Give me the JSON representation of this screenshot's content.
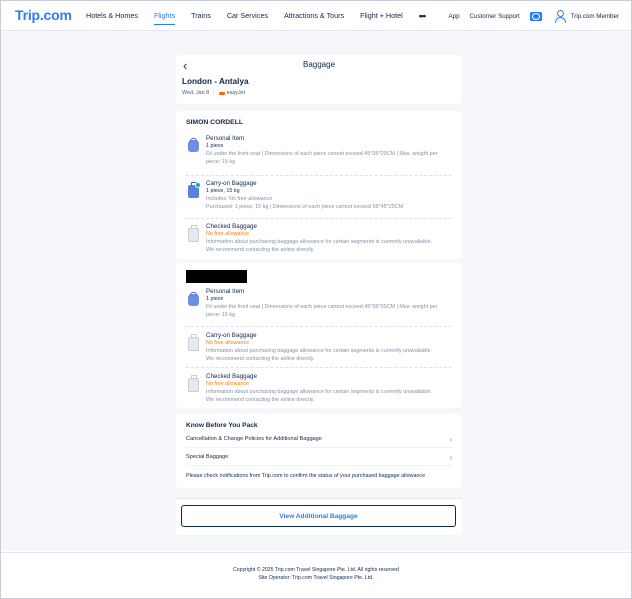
{
  "header": {
    "logo": "Trip.com",
    "nav": [
      {
        "label": "Hotels & Homes",
        "active": false
      },
      {
        "label": "Flights",
        "active": true
      },
      {
        "label": "Trains",
        "active": false
      },
      {
        "label": "Car Services",
        "active": false
      },
      {
        "label": "Attractions & Tours",
        "active": false
      },
      {
        "label": "Flight + Hotel",
        "active": false
      }
    ],
    "more_icon": "more-dots-icon",
    "app_link": "App",
    "support_link": "Customer Support",
    "member_label": "Trip.com Member"
  },
  "page": {
    "title": "Baggage",
    "route": "London - Antalya",
    "date": "Wed, Jan 8",
    "airline": "easyJet"
  },
  "passengers": [
    {
      "name": "SIMON CORDELL",
      "redacted": false,
      "items": [
        {
          "icon": "personal-item-icon",
          "title": "Personal Item",
          "sub": "1 piece",
          "sub_warn": false,
          "desc": [
            "Fit under the front seat | Dimensions of each piece cannot exceed 45*36*20CM | Max. weight per piece: 15 kg"
          ]
        },
        {
          "icon": "carry-on-icon",
          "title": "Carry-on Baggage",
          "sub": "1 piece, 15 kg",
          "sub_warn": false,
          "desc": [
            "Includes:  No free allowance",
            "Purchased: 1 piece, 15 kg | Dimensions of each piece cannot exceed 56*45*25CM"
          ]
        },
        {
          "icon": "checked-baggage-icon",
          "title": "Checked Baggage",
          "sub": "No free allowance",
          "sub_warn": true,
          "desc": [
            "Information about purchasing baggage allowance for certain segments is currently unavailable.",
            "We recommend contacting the airline directly."
          ]
        }
      ]
    },
    {
      "name": "",
      "redacted": true,
      "items": [
        {
          "icon": "personal-item-icon",
          "title": "Personal Item",
          "sub": "1 piece",
          "sub_warn": false,
          "desc": [
            "Fit under the front seat | Dimensions of each piece cannot exceed 45*36*20CM | Max. weight per piece: 15 kg"
          ]
        },
        {
          "icon": "carry-on-icon",
          "title": "Carry-on Baggage",
          "sub": "No free allowance",
          "sub_warn": true,
          "desc": [
            "Information about purchasing baggage allowance for certain segments is currently unavailable.",
            "We recommend contacting the airline directly."
          ]
        },
        {
          "icon": "checked-baggage-icon",
          "title": "Checked Baggage",
          "sub": "No free allowance",
          "sub_warn": true,
          "desc": [
            "Information about purchasing baggage allowance for certain segments is currently unavailable.",
            "We recommend contacting the airline directly."
          ]
        }
      ]
    }
  ],
  "know": {
    "title": "Know Before You Pack",
    "links": [
      "Cancellation & Change Policies for Additional Baggage",
      "Special Baggage"
    ],
    "note": "Please check notifications from Trip.com to confirm the status of your purchased baggage allowance"
  },
  "cta": {
    "label": "View Additional Baggage"
  },
  "footer": {
    "copyright": "Copyright © 2025 Trip.com Travel Singapore Pte. Ltd. All rights reserved",
    "operator": "Site Operator: Trip.com Travel Singapore Pte. Ltd."
  },
  "colors": {
    "brand": "#287dfa",
    "text": "#0f294d",
    "warning": "#ff7d00",
    "muted": "#8592a6"
  }
}
